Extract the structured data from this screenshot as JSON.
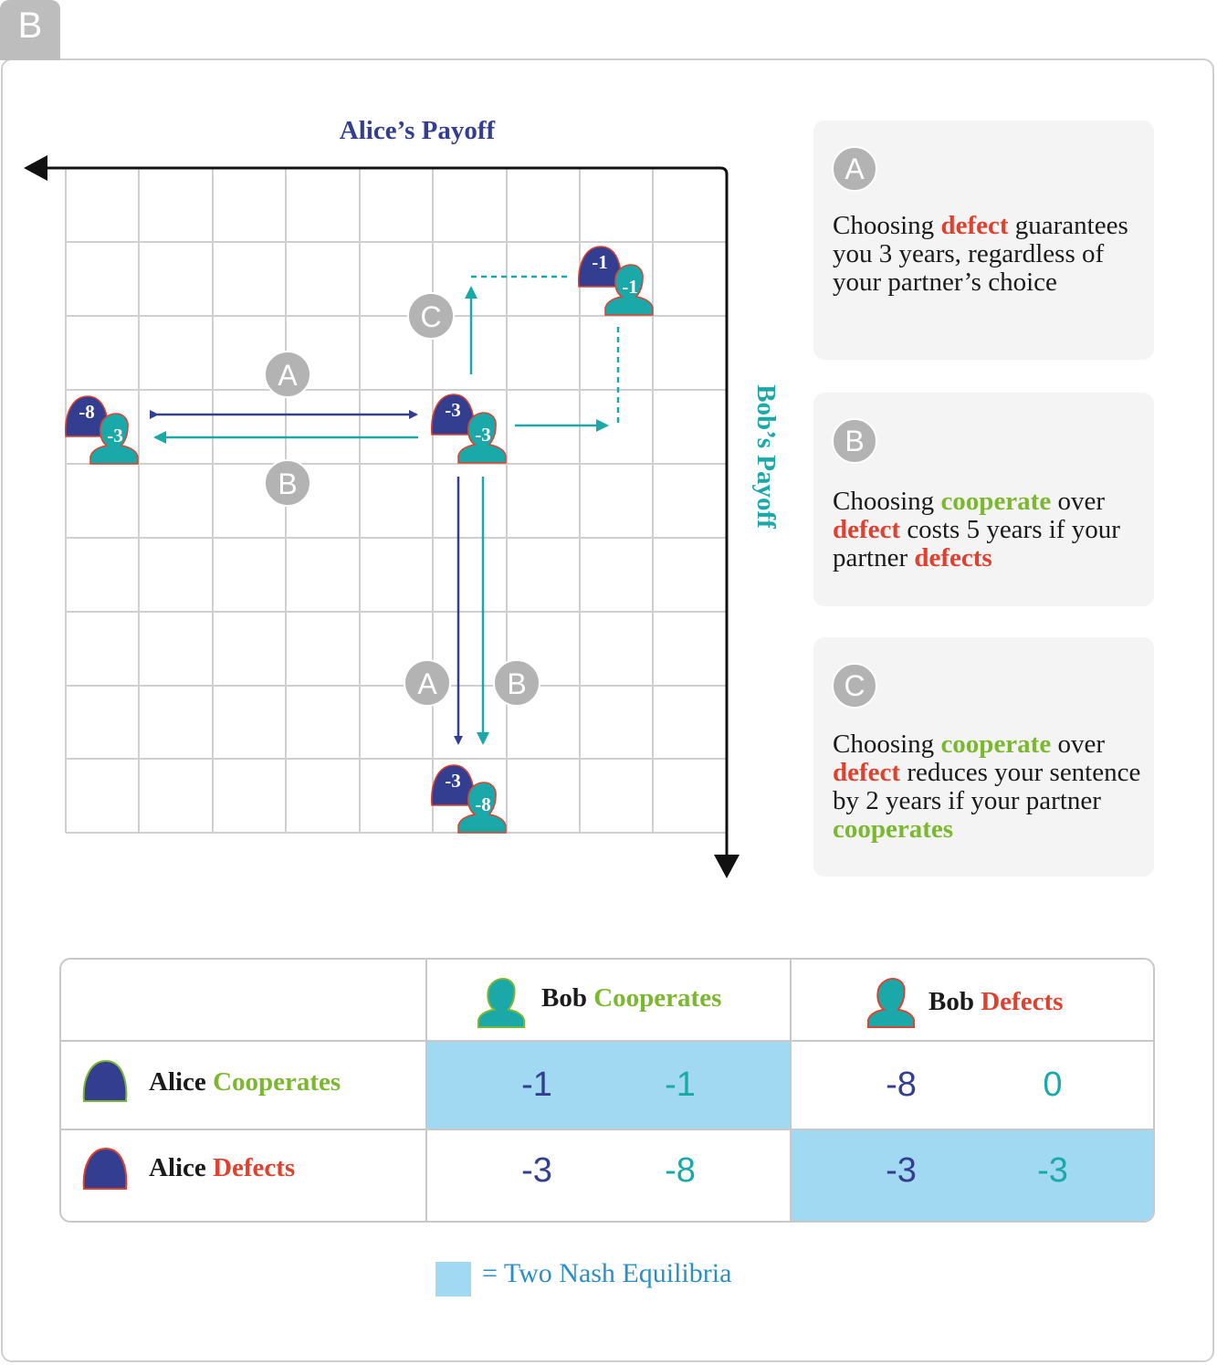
{
  "panel_label": "B",
  "axes": {
    "alice_label": "Alice’s Payoff",
    "bob_label": "Bob’s Payoff"
  },
  "colors": {
    "alice": "#343e90",
    "bob": "#1ba8a8",
    "defect": "#e0412f",
    "cooperate": "#7cb82f",
    "nash_highlight": "#a1d9f2",
    "badge": "#b3b3b3"
  },
  "outcomes": [
    {
      "alice": "-8",
      "bob": "-3"
    },
    {
      "alice": "-3",
      "bob": "-3"
    },
    {
      "alice": "-1",
      "bob": "-1"
    },
    {
      "alice": "-3",
      "bob": "-8"
    }
  ],
  "arrow_badges": [
    "A",
    "B",
    "C",
    "A",
    "B"
  ],
  "cards": [
    {
      "badge": "A",
      "segments": [
        {
          "text": "Choosing ",
          "style": "plain"
        },
        {
          "text": "defect",
          "style": "red"
        },
        {
          "text": " guarantees you 3 years, regardless of your partner’s choice",
          "style": "plain"
        }
      ]
    },
    {
      "badge": "B",
      "segments": [
        {
          "text": "Choosing ",
          "style": "plain"
        },
        {
          "text": "cooperate",
          "style": "green"
        },
        {
          "text": " over ",
          "style": "plain"
        },
        {
          "text": "defect",
          "style": "red"
        },
        {
          "text": " costs 5 years if your partner ",
          "style": "plain"
        },
        {
          "text": "defects",
          "style": "red"
        }
      ]
    },
    {
      "badge": "C",
      "segments": [
        {
          "text": "Choosing ",
          "style": "plain"
        },
        {
          "text": "cooperate",
          "style": "green"
        },
        {
          "text": " over ",
          "style": "plain"
        },
        {
          "text": "defect",
          "style": "red"
        },
        {
          "text": " reduces your sentence by 2 years if your partner ",
          "style": "plain"
        },
        {
          "text": "cooperates",
          "style": "green"
        }
      ]
    }
  ],
  "table": {
    "col_headers": [
      {
        "name": "Bob",
        "action": "Cooperates",
        "action_style": "green"
      },
      {
        "name": "Bob",
        "action": "Defects",
        "action_style": "red"
      }
    ],
    "row_headers": [
      {
        "name": "Alice",
        "action": "Cooperates",
        "action_style": "green"
      },
      {
        "name": "Alice",
        "action": "Defects",
        "action_style": "red"
      }
    ],
    "cells": [
      [
        {
          "alice": "-1",
          "bob": "-1",
          "nash": true
        },
        {
          "alice": "-8",
          "bob": "0",
          "nash": false
        }
      ],
      [
        {
          "alice": "-3",
          "bob": "-8",
          "nash": false
        },
        {
          "alice": "-3",
          "bob": "-3",
          "nash": true
        }
      ]
    ]
  },
  "legend": "= Two Nash Equilibria"
}
